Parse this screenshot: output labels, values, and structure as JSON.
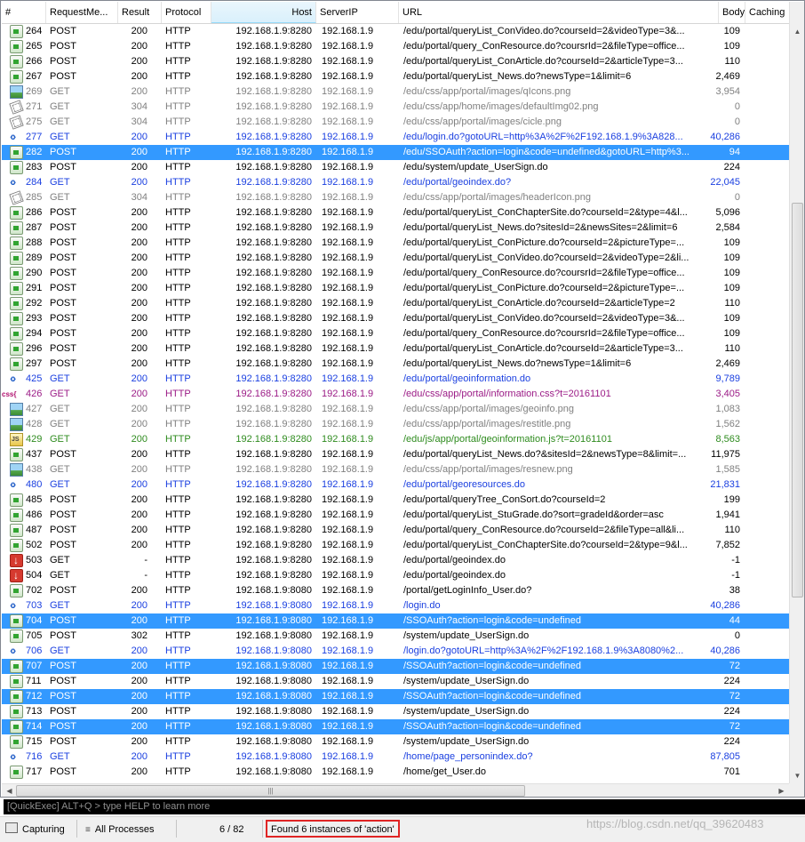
{
  "columns": [
    "#",
    "RequestMe...",
    "Result",
    "Protocol",
    "Host",
    "ServerIP",
    "URL",
    "Body",
    "Caching"
  ],
  "colors": {
    "normal": "#000000",
    "dim": "#808080",
    "redirect": "#1a3fe0",
    "css": "#9b1b86",
    "js": "#2e8b1e",
    "selected_bg": "#3399ff",
    "highlight_box": "#e02424"
  },
  "rows": [
    {
      "num": "264",
      "method": "POST",
      "result": "200",
      "protocol": "HTTP",
      "host": "192.168.1.9:8280",
      "ip": "192.168.1.9",
      "url": "/edu/portal/queryList_ConVideo.do?courseId=2&videoType=3&...",
      "body": "109",
      "icon": "post-icon",
      "style": "normal",
      "selected": false
    },
    {
      "num": "265",
      "method": "POST",
      "result": "200",
      "protocol": "HTTP",
      "host": "192.168.1.9:8280",
      "ip": "192.168.1.9",
      "url": "/edu/portal/query_ConResource.do?coursrId=2&fileType=office...",
      "body": "109",
      "icon": "post-icon",
      "style": "normal",
      "selected": false
    },
    {
      "num": "266",
      "method": "POST",
      "result": "200",
      "protocol": "HTTP",
      "host": "192.168.1.9:8280",
      "ip": "192.168.1.9",
      "url": "/edu/portal/queryList_ConArticle.do?courseId=2&articleType=3...",
      "body": "110",
      "icon": "post-icon",
      "style": "normal",
      "selected": false
    },
    {
      "num": "267",
      "method": "POST",
      "result": "200",
      "protocol": "HTTP",
      "host": "192.168.1.9:8280",
      "ip": "192.168.1.9",
      "url": "/edu/portal/queryList_News.do?newsType=1&limit=6",
      "body": "2,469",
      "icon": "post-icon",
      "style": "normal",
      "selected": false
    },
    {
      "num": "269",
      "method": "GET",
      "result": "200",
      "protocol": "HTTP",
      "host": "192.168.1.9:8280",
      "ip": "192.168.1.9",
      "url": "/edu/css/app/portal/images/qIcons.png",
      "body": "3,954",
      "icon": "image-icon",
      "style": "dim",
      "selected": false
    },
    {
      "num": "271",
      "method": "GET",
      "result": "304",
      "protocol": "HTTP",
      "host": "192.168.1.9:8280",
      "ip": "192.168.1.9",
      "url": "/edu/css/app/home/images/defaultImg02.png",
      "body": "0",
      "icon": "cache-icon",
      "style": "dim",
      "selected": false
    },
    {
      "num": "275",
      "method": "GET",
      "result": "304",
      "protocol": "HTTP",
      "host": "192.168.1.9:8280",
      "ip": "192.168.1.9",
      "url": "/edu/css/app/portal/images/cicle.png",
      "body": "0",
      "icon": "cache-icon",
      "style": "dim",
      "selected": false
    },
    {
      "num": "277",
      "method": "GET",
      "result": "200",
      "protocol": "HTTP",
      "host": "192.168.1.9:8280",
      "ip": "192.168.1.9",
      "url": "/edu/login.do?gotoURL=http%3A%2F%2F192.168.1.9%3A828...",
      "body": "40,286",
      "icon": "html-icon",
      "style": "redirect",
      "selected": false
    },
    {
      "num": "282",
      "method": "POST",
      "result": "200",
      "protocol": "HTTP",
      "host": "192.168.1.9:8280",
      "ip": "192.168.1.9",
      "url": "/edu/SSOAuth?action=login&code=undefined&gotoURL=http%3...",
      "body": "94",
      "icon": "post-icon",
      "style": "normal",
      "selected": true
    },
    {
      "num": "283",
      "method": "POST",
      "result": "200",
      "protocol": "HTTP",
      "host": "192.168.1.9:8280",
      "ip": "192.168.1.9",
      "url": "/edu/system/update_UserSign.do",
      "body": "224",
      "icon": "post-icon",
      "style": "normal",
      "selected": false
    },
    {
      "num": "284",
      "method": "GET",
      "result": "200",
      "protocol": "HTTP",
      "host": "192.168.1.9:8280",
      "ip": "192.168.1.9",
      "url": "/edu/portal/geoindex.do?",
      "body": "22,045",
      "icon": "html-icon",
      "style": "redirect",
      "selected": false
    },
    {
      "num": "285",
      "method": "GET",
      "result": "304",
      "protocol": "HTTP",
      "host": "192.168.1.9:8280",
      "ip": "192.168.1.9",
      "url": "/edu/css/app/portal/images/headerIcon.png",
      "body": "0",
      "icon": "cache-icon",
      "style": "dim",
      "selected": false
    },
    {
      "num": "286",
      "method": "POST",
      "result": "200",
      "protocol": "HTTP",
      "host": "192.168.1.9:8280",
      "ip": "192.168.1.9",
      "url": "/edu/portal/queryList_ConChapterSite.do?courseId=2&type=4&l...",
      "body": "5,096",
      "icon": "post-icon",
      "style": "normal",
      "selected": false
    },
    {
      "num": "287",
      "method": "POST",
      "result": "200",
      "protocol": "HTTP",
      "host": "192.168.1.9:8280",
      "ip": "192.168.1.9",
      "url": "/edu/portal/queryList_News.do?sitesId=2&newsSites=2&limit=6",
      "body": "2,584",
      "icon": "post-icon",
      "style": "normal",
      "selected": false
    },
    {
      "num": "288",
      "method": "POST",
      "result": "200",
      "protocol": "HTTP",
      "host": "192.168.1.9:8280",
      "ip": "192.168.1.9",
      "url": "/edu/portal/queryList_ConPicture.do?courseId=2&pictureType=...",
      "body": "109",
      "icon": "post-icon",
      "style": "normal",
      "selected": false
    },
    {
      "num": "289",
      "method": "POST",
      "result": "200",
      "protocol": "HTTP",
      "host": "192.168.1.9:8280",
      "ip": "192.168.1.9",
      "url": "/edu/portal/queryList_ConVideo.do?courseId=2&videoType=2&li...",
      "body": "109",
      "icon": "post-icon",
      "style": "normal",
      "selected": false
    },
    {
      "num": "290",
      "method": "POST",
      "result": "200",
      "protocol": "HTTP",
      "host": "192.168.1.9:8280",
      "ip": "192.168.1.9",
      "url": "/edu/portal/query_ConResource.do?coursrId=2&fileType=office...",
      "body": "109",
      "icon": "post-icon",
      "style": "normal",
      "selected": false
    },
    {
      "num": "291",
      "method": "POST",
      "result": "200",
      "protocol": "HTTP",
      "host": "192.168.1.9:8280",
      "ip": "192.168.1.9",
      "url": "/edu/portal/queryList_ConPicture.do?courseId=2&pictureType=...",
      "body": "109",
      "icon": "post-icon",
      "style": "normal",
      "selected": false
    },
    {
      "num": "292",
      "method": "POST",
      "result": "200",
      "protocol": "HTTP",
      "host": "192.168.1.9:8280",
      "ip": "192.168.1.9",
      "url": "/edu/portal/queryList_ConArticle.do?courseId=2&articleType=2",
      "body": "110",
      "icon": "post-icon",
      "style": "normal",
      "selected": false
    },
    {
      "num": "293",
      "method": "POST",
      "result": "200",
      "protocol": "HTTP",
      "host": "192.168.1.9:8280",
      "ip": "192.168.1.9",
      "url": "/edu/portal/queryList_ConVideo.do?courseId=2&videoType=3&...",
      "body": "109",
      "icon": "post-icon",
      "style": "normal",
      "selected": false
    },
    {
      "num": "294",
      "method": "POST",
      "result": "200",
      "protocol": "HTTP",
      "host": "192.168.1.9:8280",
      "ip": "192.168.1.9",
      "url": "/edu/portal/query_ConResource.do?coursrId=2&fileType=office...",
      "body": "109",
      "icon": "post-icon",
      "style": "normal",
      "selected": false
    },
    {
      "num": "296",
      "method": "POST",
      "result": "200",
      "protocol": "HTTP",
      "host": "192.168.1.9:8280",
      "ip": "192.168.1.9",
      "url": "/edu/portal/queryList_ConArticle.do?courseId=2&articleType=3...",
      "body": "110",
      "icon": "post-icon",
      "style": "normal",
      "selected": false
    },
    {
      "num": "297",
      "method": "POST",
      "result": "200",
      "protocol": "HTTP",
      "host": "192.168.1.9:8280",
      "ip": "192.168.1.9",
      "url": "/edu/portal/queryList_News.do?newsType=1&limit=6",
      "body": "2,469",
      "icon": "post-icon",
      "style": "normal",
      "selected": false
    },
    {
      "num": "425",
      "method": "GET",
      "result": "200",
      "protocol": "HTTP",
      "host": "192.168.1.9:8280",
      "ip": "192.168.1.9",
      "url": "/edu/portal/geoinformation.do",
      "body": "9,789",
      "icon": "html-icon",
      "style": "redirect",
      "selected": false
    },
    {
      "num": "426",
      "method": "GET",
      "result": "200",
      "protocol": "HTTP",
      "host": "192.168.1.9:8280",
      "ip": "192.168.1.9",
      "url": "/edu/css/app/portal/information.css?t=20161101",
      "body": "3,405",
      "icon": "css-icon",
      "style": "css",
      "selected": false
    },
    {
      "num": "427",
      "method": "GET",
      "result": "200",
      "protocol": "HTTP",
      "host": "192.168.1.9:8280",
      "ip": "192.168.1.9",
      "url": "/edu/css/app/portal/images/geoinfo.png",
      "body": "1,083",
      "icon": "image-icon",
      "style": "dim",
      "selected": false
    },
    {
      "num": "428",
      "method": "GET",
      "result": "200",
      "protocol": "HTTP",
      "host": "192.168.1.9:8280",
      "ip": "192.168.1.9",
      "url": "/edu/css/app/portal/images/restitle.png",
      "body": "1,562",
      "icon": "image-icon",
      "style": "dim",
      "selected": false
    },
    {
      "num": "429",
      "method": "GET",
      "result": "200",
      "protocol": "HTTP",
      "host": "192.168.1.9:8280",
      "ip": "192.168.1.9",
      "url": "/edu/js/app/portal/geoinformation.js?t=20161101",
      "body": "8,563",
      "icon": "js-icon",
      "style": "js",
      "selected": false
    },
    {
      "num": "437",
      "method": "POST",
      "result": "200",
      "protocol": "HTTP",
      "host": "192.168.1.9:8280",
      "ip": "192.168.1.9",
      "url": "/edu/portal/queryList_News.do?&sitesId=2&newsType=8&limit=...",
      "body": "11,975",
      "icon": "post-icon",
      "style": "normal",
      "selected": false
    },
    {
      "num": "438",
      "method": "GET",
      "result": "200",
      "protocol": "HTTP",
      "host": "192.168.1.9:8280",
      "ip": "192.168.1.9",
      "url": "/edu/css/app/portal/images/resnew.png",
      "body": "1,585",
      "icon": "image-icon",
      "style": "dim",
      "selected": false
    },
    {
      "num": "480",
      "method": "GET",
      "result": "200",
      "protocol": "HTTP",
      "host": "192.168.1.9:8280",
      "ip": "192.168.1.9",
      "url": "/edu/portal/georesources.do",
      "body": "21,831",
      "icon": "html-icon",
      "style": "redirect",
      "selected": false
    },
    {
      "num": "485",
      "method": "POST",
      "result": "200",
      "protocol": "HTTP",
      "host": "192.168.1.9:8280",
      "ip": "192.168.1.9",
      "url": "/edu/portal/queryTree_ConSort.do?courseId=2",
      "body": "199",
      "icon": "post-icon",
      "style": "normal",
      "selected": false
    },
    {
      "num": "486",
      "method": "POST",
      "result": "200",
      "protocol": "HTTP",
      "host": "192.168.1.9:8280",
      "ip": "192.168.1.9",
      "url": "/edu/portal/queryList_StuGrade.do?sort=gradeId&order=asc",
      "body": "1,941",
      "icon": "post-icon",
      "style": "normal",
      "selected": false
    },
    {
      "num": "487",
      "method": "POST",
      "result": "200",
      "protocol": "HTTP",
      "host": "192.168.1.9:8280",
      "ip": "192.168.1.9",
      "url": "/edu/portal/query_ConResource.do?courseId=2&fileType=all&li...",
      "body": "110",
      "icon": "post-icon",
      "style": "normal",
      "selected": false
    },
    {
      "num": "502",
      "method": "POST",
      "result": "200",
      "protocol": "HTTP",
      "host": "192.168.1.9:8280",
      "ip": "192.168.1.9",
      "url": "/edu/portal/queryList_ConChapterSite.do?courseId=2&type=9&l...",
      "body": "7,852",
      "icon": "post-icon",
      "style": "normal",
      "selected": false
    },
    {
      "num": "503",
      "method": "GET",
      "result": "-",
      "protocol": "HTTP",
      "host": "192.168.1.9:8280",
      "ip": "192.168.1.9",
      "url": "/edu/portal/geoindex.do",
      "body": "-1",
      "icon": "aborted-icon",
      "style": "normal",
      "selected": false
    },
    {
      "num": "504",
      "method": "GET",
      "result": "-",
      "protocol": "HTTP",
      "host": "192.168.1.9:8280",
      "ip": "192.168.1.9",
      "url": "/edu/portal/geoindex.do",
      "body": "-1",
      "icon": "aborted-icon",
      "style": "normal",
      "selected": false
    },
    {
      "num": "702",
      "method": "POST",
      "result": "200",
      "protocol": "HTTP",
      "host": "192.168.1.9:8080",
      "ip": "192.168.1.9",
      "url": "/portal/getLoginInfo_User.do?",
      "body": "38",
      "icon": "post-icon",
      "style": "normal",
      "selected": false
    },
    {
      "num": "703",
      "method": "GET",
      "result": "200",
      "protocol": "HTTP",
      "host": "192.168.1.9:8080",
      "ip": "192.168.1.9",
      "url": "/login.do",
      "body": "40,286",
      "icon": "html-icon",
      "style": "redirect",
      "selected": false
    },
    {
      "num": "704",
      "method": "POST",
      "result": "200",
      "protocol": "HTTP",
      "host": "192.168.1.9:8080",
      "ip": "192.168.1.9",
      "url": "/SSOAuth?action=login&code=undefined",
      "body": "44",
      "icon": "post-icon",
      "style": "normal",
      "selected": true
    },
    {
      "num": "705",
      "method": "POST",
      "result": "302",
      "protocol": "HTTP",
      "host": "192.168.1.9:8080",
      "ip": "192.168.1.9",
      "url": "/system/update_UserSign.do",
      "body": "0",
      "icon": "post-icon",
      "style": "normal",
      "selected": false
    },
    {
      "num": "706",
      "method": "GET",
      "result": "200",
      "protocol": "HTTP",
      "host": "192.168.1.9:8080",
      "ip": "192.168.1.9",
      "url": "/login.do?gotoURL=http%3A%2F%2F192.168.1.9%3A8080%2...",
      "body": "40,286",
      "icon": "html-icon",
      "style": "redirect",
      "selected": false
    },
    {
      "num": "707",
      "method": "POST",
      "result": "200",
      "protocol": "HTTP",
      "host": "192.168.1.9:8080",
      "ip": "192.168.1.9",
      "url": "/SSOAuth?action=login&code=undefined",
      "body": "72",
      "icon": "post-icon",
      "style": "normal",
      "selected": true
    },
    {
      "num": "711",
      "method": "POST",
      "result": "200",
      "protocol": "HTTP",
      "host": "192.168.1.9:8080",
      "ip": "192.168.1.9",
      "url": "/system/update_UserSign.do",
      "body": "224",
      "icon": "post-icon",
      "style": "normal",
      "selected": false
    },
    {
      "num": "712",
      "method": "POST",
      "result": "200",
      "protocol": "HTTP",
      "host": "192.168.1.9:8080",
      "ip": "192.168.1.9",
      "url": "/SSOAuth?action=login&code=undefined",
      "body": "72",
      "icon": "post-icon",
      "style": "normal",
      "selected": true
    },
    {
      "num": "713",
      "method": "POST",
      "result": "200",
      "protocol": "HTTP",
      "host": "192.168.1.9:8080",
      "ip": "192.168.1.9",
      "url": "/system/update_UserSign.do",
      "body": "224",
      "icon": "post-icon",
      "style": "normal",
      "selected": false
    },
    {
      "num": "714",
      "method": "POST",
      "result": "200",
      "protocol": "HTTP",
      "host": "192.168.1.9:8080",
      "ip": "192.168.1.9",
      "url": "/SSOAuth?action=login&code=undefined",
      "body": "72",
      "icon": "post-icon",
      "style": "normal",
      "selected": true
    },
    {
      "num": "715",
      "method": "POST",
      "result": "200",
      "protocol": "HTTP",
      "host": "192.168.1.9:8080",
      "ip": "192.168.1.9",
      "url": "/system/update_UserSign.do",
      "body": "224",
      "icon": "post-icon",
      "style": "normal",
      "selected": false
    },
    {
      "num": "716",
      "method": "GET",
      "result": "200",
      "protocol": "HTTP",
      "host": "192.168.1.9:8080",
      "ip": "192.168.1.9",
      "url": "/home/page_personindex.do?",
      "body": "87,805",
      "icon": "html-icon",
      "style": "redirect",
      "selected": false
    },
    {
      "num": "717",
      "method": "POST",
      "result": "200",
      "protocol": "HTTP",
      "host": "192.168.1.9:8080",
      "ip": "192.168.1.9",
      "url": "/home/get_User.do",
      "body": "701",
      "icon": "post-icon",
      "style": "normal",
      "selected": false
    }
  ],
  "quickexec": {
    "placeholder": "[QuickExec] ALT+Q > type HELP to learn more"
  },
  "status": {
    "capturing": "Capturing",
    "processes": "All Processes",
    "count": "6 / 82",
    "found": "Found 6 instances of 'action'"
  },
  "watermark": "https://blog.csdn.net/qq_39620483"
}
